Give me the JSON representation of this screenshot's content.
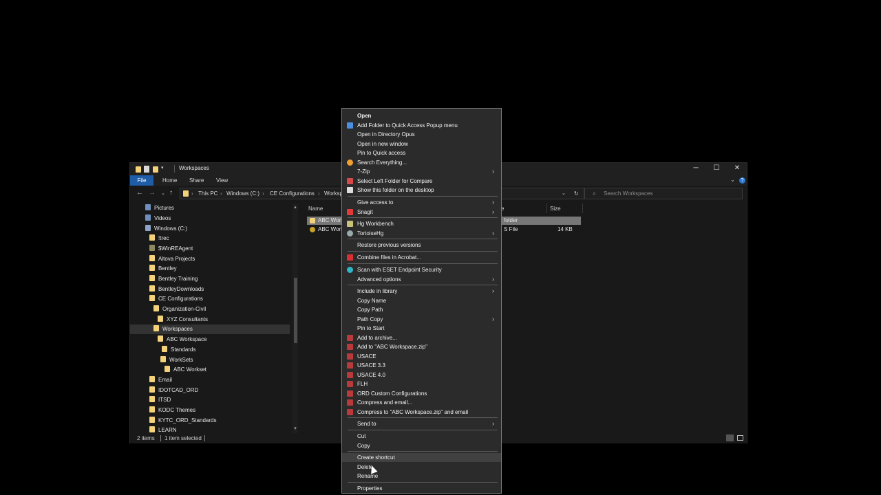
{
  "window": {
    "title": "Workspaces",
    "ribbon_tabs": [
      "File",
      "Home",
      "Share",
      "View"
    ],
    "controls": {
      "minimize": "─",
      "maximize": "☐",
      "close": "✕"
    },
    "accent": "#1f5da8"
  },
  "address": {
    "crumbs": [
      "This PC",
      "Windows (C:)",
      "CE Configurations",
      "Worksp"
    ],
    "separator": "›",
    "search_placeholder": "Search Workspaces"
  },
  "nav_pane": {
    "items": [
      {
        "label": "Pictures",
        "icon": "pictures-icon",
        "selected": false
      },
      {
        "label": "Videos",
        "icon": "videos-icon",
        "selected": false
      },
      {
        "label": "Windows (C:)",
        "icon": "drive-icon",
        "selected": false
      },
      {
        "label": "!trec",
        "icon": "folder-icon",
        "selected": false
      },
      {
        "label": "$WinREAgent",
        "icon": "folder-icon",
        "selected": false
      },
      {
        "label": "Altova Projects",
        "icon": "folder-icon",
        "selected": false
      },
      {
        "label": "Bentley",
        "icon": "folder-icon",
        "selected": false
      },
      {
        "label": "Bentley Training",
        "icon": "folder-icon",
        "selected": false
      },
      {
        "label": "BentleyDownloads",
        "icon": "folder-icon",
        "selected": false
      },
      {
        "label": "CE Configurations",
        "icon": "folder-icon",
        "selected": false
      },
      {
        "label": "Organization-Civil",
        "icon": "folder-icon",
        "selected": false
      },
      {
        "label": "XYZ Consultants",
        "icon": "folder-icon",
        "selected": false
      },
      {
        "label": "Workspaces",
        "icon": "folder-icon",
        "selected": true
      },
      {
        "label": "ABC Workspace",
        "icon": "folder-icon",
        "selected": false
      },
      {
        "label": "Standards",
        "icon": "folder-icon",
        "selected": false
      },
      {
        "label": "WorkSets",
        "icon": "folder-icon",
        "selected": false
      },
      {
        "label": "ABC Workset",
        "icon": "folder-icon",
        "selected": false
      },
      {
        "label": "Email",
        "icon": "folder-icon",
        "selected": false
      },
      {
        "label": "IDOTCAD_ORD",
        "icon": "folder-icon",
        "selected": false
      },
      {
        "label": "ITSD",
        "icon": "folder-icon",
        "selected": false
      },
      {
        "label": "KODC Themes",
        "icon": "folder-icon",
        "selected": false
      },
      {
        "label": "KYTC_ORD_Standards",
        "icon": "folder-icon",
        "selected": false
      },
      {
        "label": "LEARN",
        "icon": "folder-icon",
        "selected": false
      }
    ]
  },
  "content": {
    "columns": {
      "name": "Name",
      "type": "e",
      "size": "Size"
    },
    "rows": [
      {
        "name": "ABC Work",
        "type": "folder",
        "size": "",
        "selected": true,
        "icon": "folder-icon"
      },
      {
        "name": "ABC Work",
        "type": "S File",
        "size": "14 KB",
        "selected": false,
        "icon": "cfg-file-icon"
      }
    ]
  },
  "status": {
    "items": "2 items",
    "selected": "1 item selected"
  },
  "context_menu": {
    "items": [
      {
        "label": "Open",
        "bold": true,
        "icon": "",
        "submenu": false
      },
      {
        "label": "Add Folder to Quick Access Popup menu",
        "icon": "quick-access-icon",
        "submenu": false
      },
      {
        "label": "Open in Directory Opus",
        "icon": "",
        "submenu": false
      },
      {
        "label": "Open in new window",
        "icon": "",
        "submenu": false
      },
      {
        "label": "Pin to Quick access",
        "icon": "",
        "submenu": false
      },
      {
        "label": "Search Everything...",
        "icon": "search-icon",
        "submenu": false
      },
      {
        "label": "7-Zip",
        "icon": "",
        "submenu": true
      },
      {
        "label": "Select Left Folder for Compare",
        "icon": "compare-icon",
        "submenu": false
      },
      {
        "label": "Show this folder on the desktop",
        "icon": "desktop-icon",
        "submenu": false,
        "sep_after": true
      },
      {
        "label": "Give access to",
        "icon": "",
        "submenu": true
      },
      {
        "label": "Snagit",
        "icon": "snagit-icon",
        "submenu": true,
        "sep_after": true
      },
      {
        "label": "Hg Workbench",
        "icon": "hg-icon",
        "submenu": false
      },
      {
        "label": "TortoiseHg",
        "icon": "tortoise-icon",
        "submenu": true,
        "sep_after": true
      },
      {
        "label": "Restore previous versions",
        "icon": "",
        "submenu": false,
        "sep_after": true
      },
      {
        "label": "Combine files in Acrobat...",
        "icon": "acrobat-icon",
        "submenu": false,
        "sep_after": true
      },
      {
        "label": "Scan with ESET Endpoint Security",
        "icon": "eset-icon",
        "submenu": false
      },
      {
        "label": "Advanced options",
        "icon": "",
        "submenu": true,
        "sep_after": true
      },
      {
        "label": "Include in library",
        "icon": "",
        "submenu": true
      },
      {
        "label": "Copy Name",
        "icon": "",
        "submenu": false
      },
      {
        "label": "Copy Path",
        "icon": "",
        "submenu": false
      },
      {
        "label": "Path Copy",
        "icon": "",
        "submenu": true
      },
      {
        "label": "Pin to Start",
        "icon": "",
        "submenu": false
      },
      {
        "label": "Add to archive...",
        "icon": "archive-icon",
        "submenu": false
      },
      {
        "label": "Add to \"ABC Workspace.zip\"",
        "icon": "archive-icon",
        "submenu": false
      },
      {
        "label": "USACE",
        "icon": "archive-icon",
        "submenu": false
      },
      {
        "label": "USACE 3.3",
        "icon": "archive-icon",
        "submenu": false
      },
      {
        "label": "USACE 4.0",
        "icon": "archive-icon",
        "submenu": false
      },
      {
        "label": "FLH",
        "icon": "archive-icon",
        "submenu": false
      },
      {
        "label": "ORD Custom Configurations",
        "icon": "archive-icon",
        "submenu": false
      },
      {
        "label": "Compress and email...",
        "icon": "archive-icon",
        "submenu": false
      },
      {
        "label": "Compress to \"ABC Workspace.zip\" and email",
        "icon": "archive-icon",
        "submenu": false,
        "sep_after": true
      },
      {
        "label": "Send to",
        "icon": "",
        "submenu": true,
        "sep_after": true
      },
      {
        "label": "Cut",
        "icon": "",
        "submenu": false
      },
      {
        "label": "Copy",
        "icon": "",
        "submenu": false,
        "sep_after": true
      },
      {
        "label": "Create shortcut",
        "icon": "",
        "submenu": false,
        "highlighted": true
      },
      {
        "label": "Delete",
        "icon": "",
        "submenu": false
      },
      {
        "label": "Rename",
        "icon": "",
        "submenu": false,
        "sep_after": true
      },
      {
        "label": "Properties",
        "icon": "",
        "submenu": false
      }
    ]
  }
}
